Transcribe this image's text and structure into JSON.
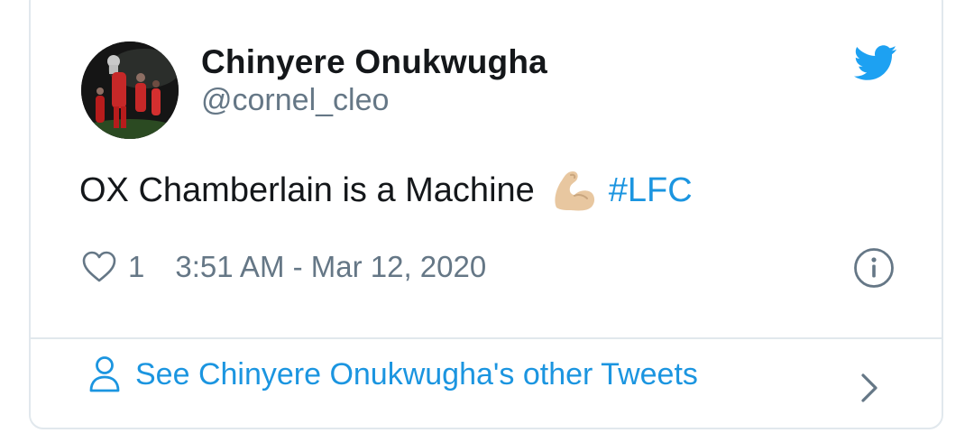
{
  "tweet": {
    "author_name": "Chinyere Onukwugha",
    "author_handle": "@cornel_cleo",
    "text": "OX Chamberlain is a Machine",
    "hashtag": "#LFC",
    "like_count": "1",
    "timestamp": "3:51 AM - Mar 12, 2020"
  },
  "footer": {
    "link_label": "See Chinyere Onukwugha's other Tweets"
  },
  "icons": {
    "brand": "twitter-bird-icon",
    "emoji": "flexed-biceps-emoji",
    "like": "heart-icon",
    "info": "info-icon",
    "person": "person-icon",
    "chevron": "chevron-right-icon"
  },
  "colors": {
    "twitter_blue": "#1da1f2",
    "link_blue": "#1b95e0",
    "text_primary": "#14171a",
    "text_secondary": "#657786",
    "border": "#e1e8ed"
  }
}
